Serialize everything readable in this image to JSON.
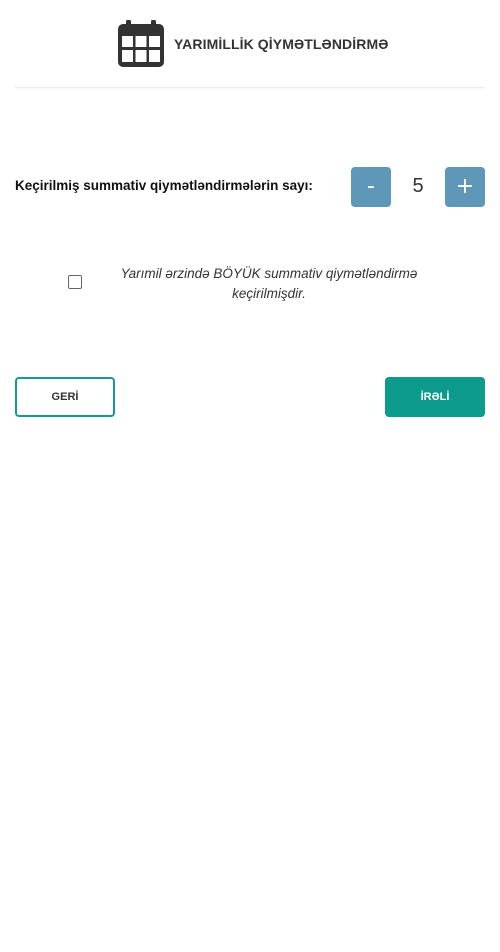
{
  "header": {
    "title": "YARIMİLLİK QİYMƏTLƏNDİRMƏ",
    "icon": "calendar-icon"
  },
  "counter": {
    "label": "Keçirilmiş summativ qiymətləndirmələrin sayı:",
    "minus_label": "-",
    "value": "5",
    "plus_label": "+",
    "button_color": "#5f97b8"
  },
  "big_summative": {
    "checked": false,
    "label": "Yarımil ərzində BÖYÜK summativ qiymətləndirmə keçirilmişdir."
  },
  "navigation": {
    "back_label": "GERİ",
    "next_label": "İRƏLİ",
    "accent_color": "#0b9a8c"
  }
}
